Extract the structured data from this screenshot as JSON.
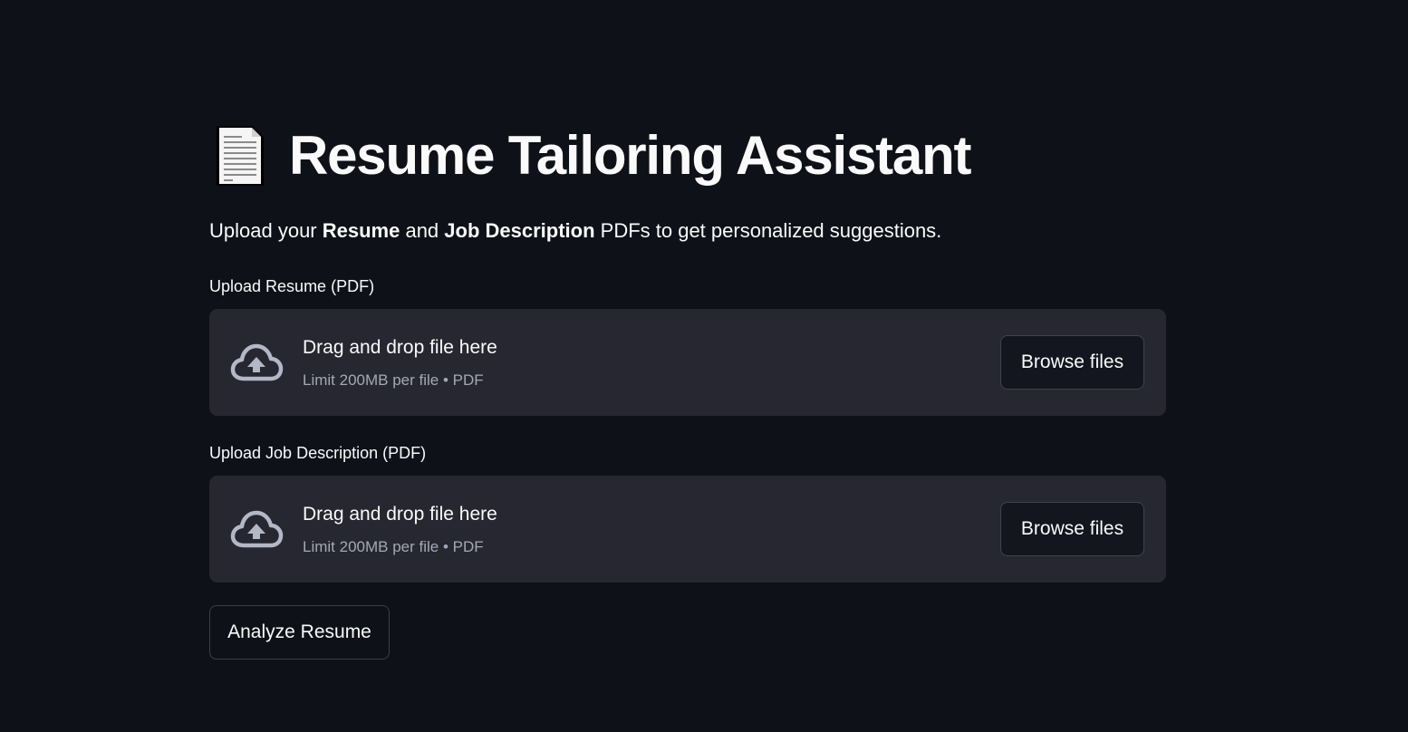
{
  "header": {
    "icon": "page-facing-up-icon",
    "title": "Resume Tailoring Assistant"
  },
  "intro": {
    "prefix": "Upload your ",
    "bold1": "Resume",
    "middle": " and ",
    "bold2": "Job Description",
    "suffix": " PDFs to get personalized suggestions."
  },
  "resume_upload": {
    "label": "Upload Resume (PDF)",
    "icon": "cloud-upload-icon",
    "drop_text": "Drag and drop file here",
    "limit_text": "Limit 200MB per file • PDF",
    "browse_label": "Browse files"
  },
  "job_upload": {
    "label": "Upload Job Description (PDF)",
    "icon": "cloud-upload-icon",
    "drop_text": "Drag and drop file here",
    "limit_text": "Limit 200MB per file • PDF",
    "browse_label": "Browse files"
  },
  "actions": {
    "analyze_label": "Analyze Resume"
  },
  "colors": {
    "background": "#0e1117",
    "dropzone": "#262730",
    "text": "#fafafa",
    "muted": "#a3a8b8"
  }
}
